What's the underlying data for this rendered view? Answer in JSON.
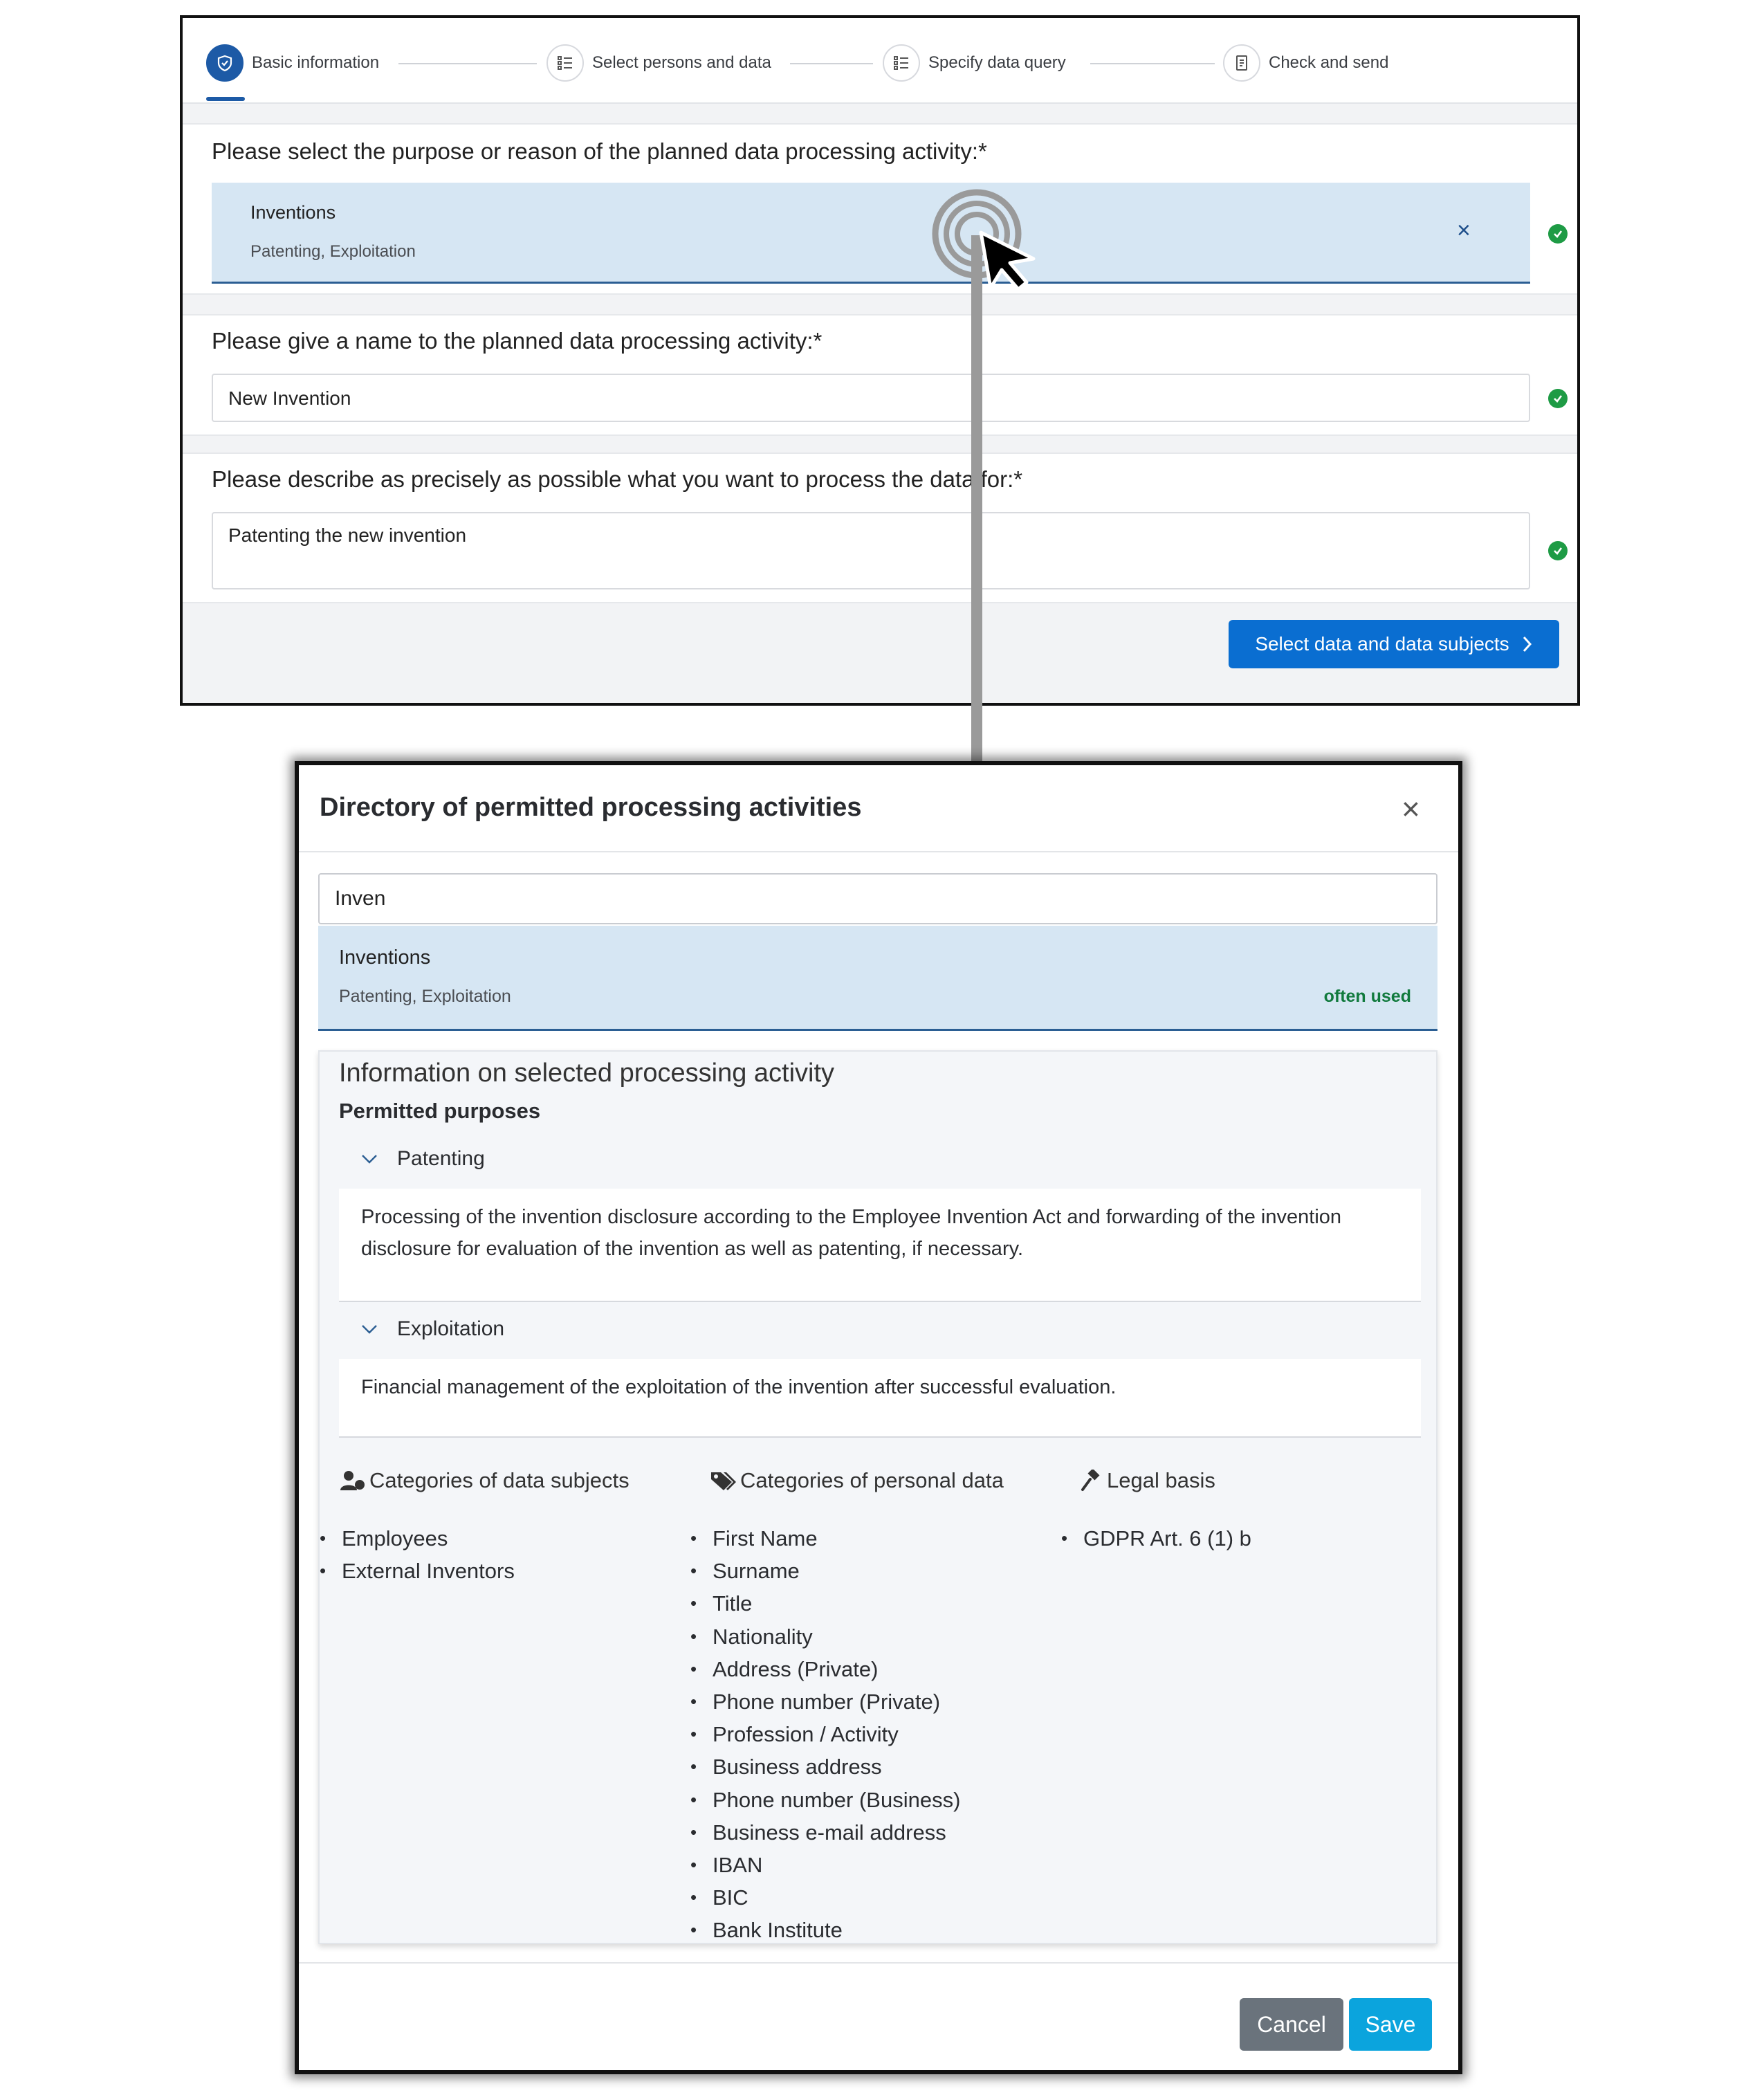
{
  "wizard": {
    "steps": [
      {
        "label": "Basic information",
        "icon": "shield-check-icon",
        "active": true
      },
      {
        "label": "Select persons and data",
        "icon": "list-icon",
        "active": false
      },
      {
        "label": "Specify data query",
        "icon": "list-icon",
        "active": false
      },
      {
        "label": "Check and send",
        "icon": "document-icon",
        "active": false
      }
    ]
  },
  "form": {
    "purpose": {
      "label": "Please select the purpose or reason of the planned data processing activity:*",
      "selected_title": "Inventions",
      "selected_subtitle": "Patenting, Exploitation",
      "clear_symbol": "×"
    },
    "name": {
      "label": "Please give a name to the planned data processing activity:*",
      "value": "New Invention"
    },
    "description": {
      "label": "Please describe as precisely as possible what you want to process the data for:*",
      "value": "Patenting the new invention"
    },
    "next_button": "Select data and data subjects",
    "valid_color": "#1e9b45",
    "primary_color": "#0a6ed1"
  },
  "dialog": {
    "title": "Directory of permitted processing activities",
    "close_symbol": "×",
    "search_value": "Inven",
    "option": {
      "title": "Inventions",
      "subtitle": "Patenting, Exploitation",
      "badge": "often used"
    },
    "info": {
      "title": "Information on selected processing activity",
      "purposes_heading": "Permitted purposes",
      "purposes": [
        {
          "name": "Patenting",
          "description": "Processing of the invention disclosure according to the Employee Invention Act and forwarding of the invention disclosure for evaluation of the invention as well as patenting, if necessary."
        },
        {
          "name": "Exploitation",
          "description": "Financial management of the exploitation of the invention after successful evaluation."
        }
      ],
      "data_subjects": {
        "heading": "Categories of data subjects",
        "icon": "users-icon",
        "items": [
          "Employees",
          "External Inventors"
        ]
      },
      "personal_data": {
        "heading": "Categories of personal data",
        "icon": "tags-icon",
        "items": [
          "First Name",
          "Surname",
          "Title",
          "Nationality",
          "Address (Private)",
          "Phone number (Private)",
          "Profession / Activity",
          "Business address",
          "Phone number (Business)",
          "Business e-mail address",
          "IBAN",
          "BIC",
          "Bank Institute"
        ]
      },
      "legal_basis": {
        "heading": "Legal basis",
        "icon": "gavel-icon",
        "items": [
          "GDPR Art. 6 (1) b"
        ]
      }
    },
    "cancel_label": "Cancel",
    "save_label": "Save"
  }
}
